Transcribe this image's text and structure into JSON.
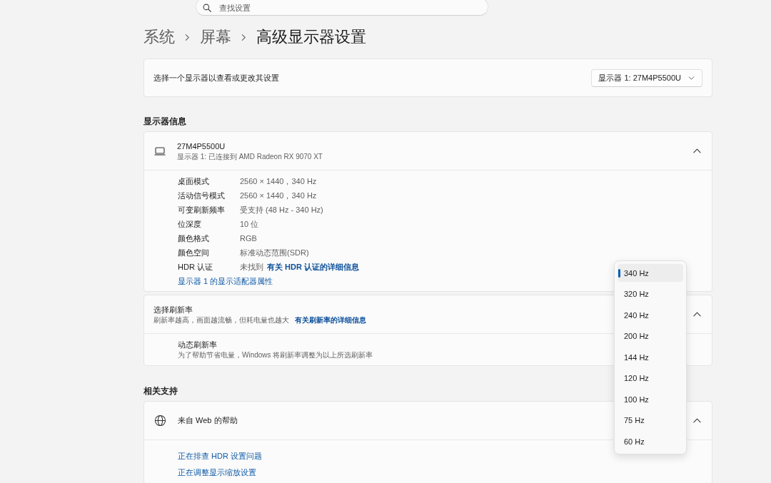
{
  "search": {
    "placeholder": "查找设置"
  },
  "breadcrumb": [
    "系统",
    "屏幕",
    "高级显示器设置"
  ],
  "display_picker": {
    "label": "选择一个显示器以查看或更改其设置",
    "value": "显示器 1: 27M4P5500U"
  },
  "display_info": {
    "heading": "显示器信息",
    "name": "27M4P5500U",
    "subtitle": "显示器 1: 已连接到 AMD Radeon RX 9070 XT",
    "expanded": true,
    "properties": [
      {
        "label": "桌面模式",
        "value": "2560 × 1440，340 Hz"
      },
      {
        "label": "活动信号模式",
        "value": "2560 × 1440，340 Hz"
      },
      {
        "label": "可变刷新频率",
        "value": "受支持 (48 Hz - 340 Hz)"
      },
      {
        "label": "位深度",
        "value": "10 位"
      },
      {
        "label": "颜色格式",
        "value": "RGB"
      },
      {
        "label": "颜色空间",
        "value": "标准动态范围(SDR)"
      },
      {
        "label": "HDR 认证",
        "value": "未找到",
        "link": "有关 HDR 认证的详细信息"
      }
    ],
    "adapter_link": "显示器 1 的显示适配器属性"
  },
  "refresh_rate": {
    "title": "选择刷新率",
    "description": "刷新率越高，画面越流畅，但耗电量也越大",
    "link": "有关刷新率的详细信息",
    "expanded": true,
    "dynamic_refresh": {
      "title": "动态刷新率",
      "description": "为了帮助节省电量，Windows 将刷新率调整为以上所选刷新率"
    },
    "options": [
      {
        "label": "340 Hz",
        "selected": true
      },
      {
        "label": "320 Hz",
        "selected": false
      },
      {
        "label": "240 Hz",
        "selected": false
      },
      {
        "label": "200 Hz",
        "selected": false
      },
      {
        "label": "144 Hz",
        "selected": false
      },
      {
        "label": "120 Hz",
        "selected": false
      },
      {
        "label": "100 Hz",
        "selected": false
      },
      {
        "label": "75 Hz",
        "selected": false
      },
      {
        "label": "60 Hz",
        "selected": false
      }
    ]
  },
  "related_support": {
    "heading": "相关支持",
    "title": "来自 Web 的帮助",
    "expanded": true,
    "links": [
      "正在排查 HDR 设置问题",
      "正在调整显示缩放设置"
    ]
  }
}
